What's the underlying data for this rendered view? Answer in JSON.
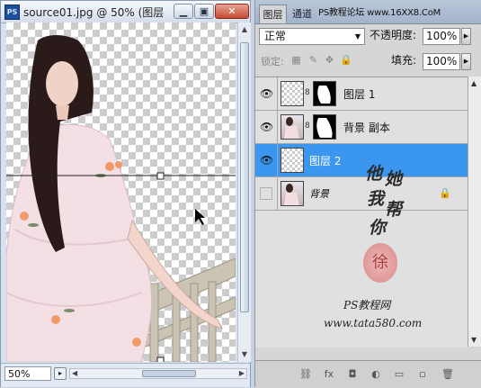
{
  "document": {
    "title": "source01.jpg @ 50% (图层",
    "icon": "PS",
    "buttons": {
      "minimize": "▁",
      "restore": "▣",
      "close": "✕"
    },
    "zoom": "50%",
    "guide_y_fraction": 0.45
  },
  "layers_panel": {
    "tabs": [
      "图层",
      "通道"
    ],
    "watermark": "PS教程论坛 www.16XX8.CoM",
    "blend_mode": "正常",
    "opacity_label": "不透明度:",
    "opacity_value": "100%",
    "lock_label": "锁定:",
    "fill_label": "填充:",
    "fill_value": "100%",
    "layers": [
      {
        "name": "图层 1",
        "visible": true,
        "selected": false,
        "has_mask": true,
        "thumb": "transparent"
      },
      {
        "name": "背景 副本",
        "visible": true,
        "selected": false,
        "has_mask": true,
        "thumb": "photo"
      },
      {
        "name": "图层 2",
        "visible": true,
        "selected": true,
        "has_mask": false,
        "thumb": "transparent"
      },
      {
        "name": "背景",
        "visible": false,
        "selected": false,
        "has_mask": false,
        "thumb": "photo",
        "locked": true
      }
    ],
    "bottom_icons": [
      "link-icon",
      "fx-icon",
      "mask-icon",
      "adjustment-icon",
      "group-icon",
      "new-layer-icon",
      "trash-icon"
    ],
    "bottom_glyphs": [
      "⛓",
      "fx",
      "◘",
      "◐",
      "▭",
      "▫",
      "🗑"
    ]
  },
  "signature": {
    "chars": [
      "他",
      "她",
      "我",
      "帮",
      "你"
    ],
    "seal": "徐",
    "line1": "PS教程网",
    "line2": "www.tata580.com"
  },
  "colors": {
    "selection": "#3b96f0",
    "titlebar": "#d3deeb",
    "panel": "#d6d6d6"
  }
}
